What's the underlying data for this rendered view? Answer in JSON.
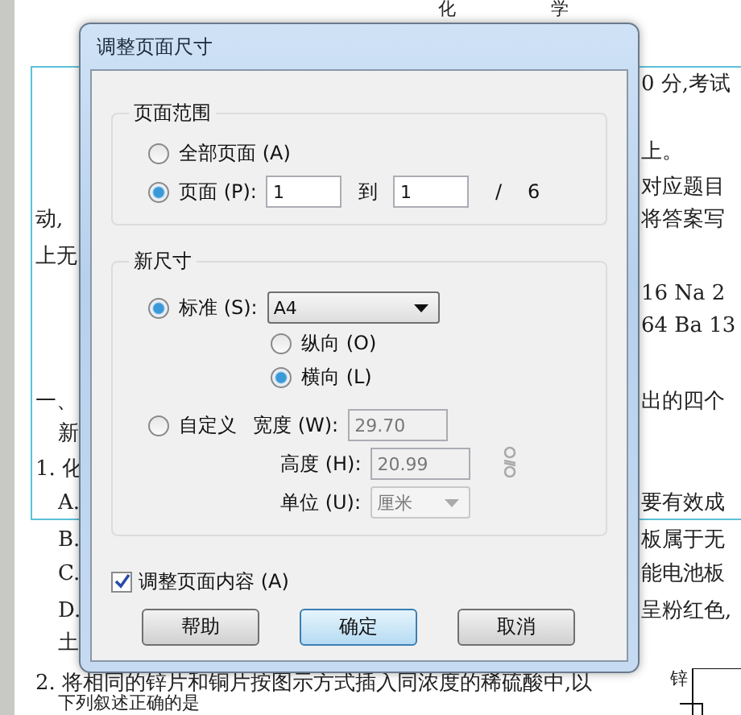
{
  "document": {
    "title": [
      "化",
      "学"
    ],
    "right_fragments": [
      "0 分,考试",
      "上。",
      "对应题目",
      "将答案写",
      "16   Na 2",
      "64   Ba 13",
      "出的四个",
      "要有效成",
      "板属于无",
      "能电池板",
      "呈粉红色,"
    ],
    "left_fragments": [
      "动,",
      "上无",
      "一、",
      "新",
      "1. 化",
      "A.",
      "B.",
      "C.",
      "D.",
      "土"
    ],
    "bottom_lines": [
      "2. 将相同的锌片和铜片按图示方式插入同浓度的稀硫酸中,以",
      "下列叙述正确的是"
    ],
    "diagram_label": "锌"
  },
  "dialog": {
    "title": "调整页面尺寸",
    "page_range": {
      "legend": "页面范围",
      "options": [
        {
          "label": "全部页面 (A)",
          "selected": false
        },
        {
          "label": "页面 (P):",
          "selected": true
        }
      ],
      "from": "1",
      "to_label": "到",
      "to": "1",
      "separator": "/",
      "total": "6"
    },
    "new_size": {
      "legend": "新尺寸",
      "standard": {
        "label": "标准 (S):",
        "selected": true,
        "value": "A4"
      },
      "orientations": [
        {
          "label": "纵向 (O)",
          "selected": false
        },
        {
          "label": "横向 (L)",
          "selected": true
        }
      ],
      "custom": {
        "label": "自定义",
        "selected": false,
        "fields": [
          {
            "label": "宽度 (W):",
            "value": "29.70"
          },
          {
            "label": "高度 (H):",
            "value": "20.99"
          }
        ],
        "unit": {
          "label": "单位 (U):",
          "value": "厘米"
        }
      }
    },
    "adjust_content": {
      "label": "调整页面内容 (A)",
      "checked": true
    },
    "buttons": [
      {
        "label": "帮助",
        "default": false
      },
      {
        "label": "确定",
        "default": true
      },
      {
        "label": "取消",
        "default": false
      }
    ]
  }
}
